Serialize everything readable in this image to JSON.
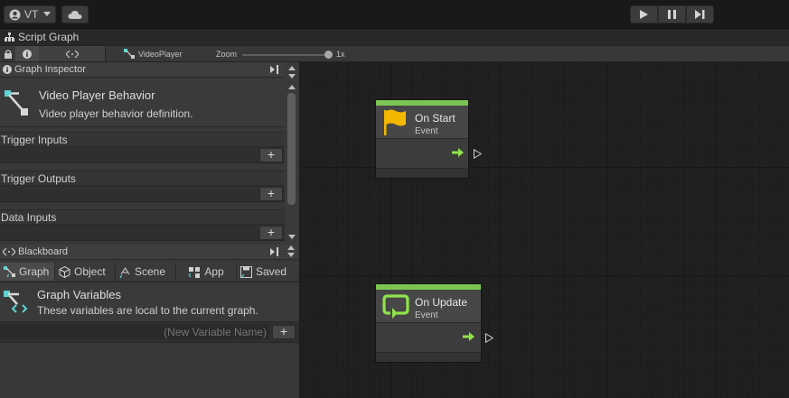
{
  "toolbar": {
    "account_label": "VT",
    "account_icon": "account-icon",
    "cloud_icon": "cloud-icon",
    "play_icon": "play-icon",
    "pause_icon": "pause-icon",
    "step_icon": "step-icon"
  },
  "window": {
    "title": "Script Graph"
  },
  "graph_toolbar": {
    "lock_icon": "lock-icon",
    "info_icon": "info-icon",
    "overview_icon": "code-brackets-icon",
    "graph_name": "VideoPlayer",
    "zoom_label": "Zoom",
    "zoom_value": "1x",
    "zoom_level": 1.0
  },
  "inspector": {
    "header": "Graph Inspector",
    "graph_title": "Video Player Behavior",
    "graph_description": "Video player behavior definition.",
    "sections": [
      {
        "label": "Trigger Inputs"
      },
      {
        "label": "Trigger Outputs"
      },
      {
        "label": "Data Inputs"
      }
    ],
    "add_label": "+"
  },
  "blackboard": {
    "header": "Blackboard",
    "tabs": [
      {
        "label": "Graph",
        "icon": "graph-icon",
        "active": true
      },
      {
        "label": "Object",
        "icon": "cube-icon",
        "active": false
      },
      {
        "label": "Scene",
        "icon": "scene-icon",
        "active": false
      },
      {
        "label": "App",
        "icon": "app-icon",
        "active": false
      },
      {
        "label": "Saved",
        "icon": "saved-icon",
        "active": false
      }
    ],
    "variables_title": "Graph Variables",
    "variables_description": "These variables are local to the current graph.",
    "new_variable_placeholder": "(New Variable Name)",
    "add_label": "+"
  },
  "nodes": [
    {
      "title": "On Start",
      "subtitle": "Event",
      "icon": "flag-icon"
    },
    {
      "title": "On Update",
      "subtitle": "Event",
      "icon": "update-loop-icon"
    }
  ],
  "colors": {
    "event_header": "#7bc652",
    "flow_arrow": "#8fe34a",
    "flag": "#f5b800",
    "graph_icon": "#5fd3d3"
  }
}
